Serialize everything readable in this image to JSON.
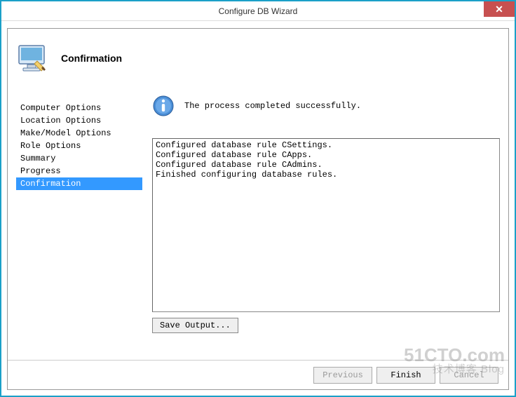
{
  "window": {
    "title": "Configure DB Wizard",
    "close": "✕"
  },
  "header": {
    "heading": "Confirmation"
  },
  "sidebar": {
    "items": [
      {
        "label": "Computer Options",
        "selected": false
      },
      {
        "label": "Location Options",
        "selected": false
      },
      {
        "label": "Make/Model Options",
        "selected": false
      },
      {
        "label": "Role Options",
        "selected": false
      },
      {
        "label": "Summary",
        "selected": false
      },
      {
        "label": "Progress",
        "selected": false
      },
      {
        "label": "Confirmation",
        "selected": true
      }
    ]
  },
  "main": {
    "status_message": "The process completed successfully.",
    "output_lines": [
      "Configured database rule CSettings.",
      "Configured database rule CApps.",
      "Configured database rule CAdmins.",
      "Finished configuring database rules."
    ],
    "save_output_label": "Save Output..."
  },
  "footer": {
    "previous_label": "Previous",
    "finish_label": "Finish",
    "cancel_label": "Cancel"
  },
  "watermark": {
    "line1": "51CTO.com",
    "line2": "技术博客 Blog"
  }
}
